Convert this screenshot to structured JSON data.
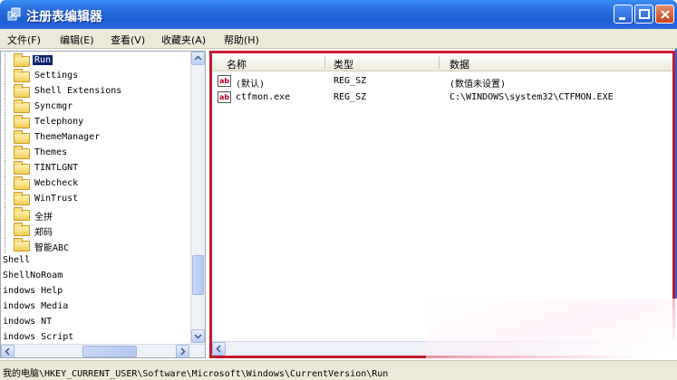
{
  "window": {
    "title": "注册表编辑器",
    "title_icon": "regedit-icon"
  },
  "menu": {
    "items": [
      {
        "label": "文件(F)"
      },
      {
        "label": "编辑(E)"
      },
      {
        "label": "查看(V)"
      },
      {
        "label": "收藏夹(A)"
      },
      {
        "label": "帮助(H)"
      }
    ]
  },
  "tree": {
    "items": [
      {
        "label": "Run",
        "selected": true,
        "folder": true
      },
      {
        "label": "Settings",
        "folder": true
      },
      {
        "label": "Shell Extensions",
        "folder": true
      },
      {
        "label": "Syncmgr",
        "folder": true
      },
      {
        "label": "Telephony",
        "folder": true
      },
      {
        "label": "ThemeManager",
        "folder": true
      },
      {
        "label": "Themes",
        "folder": true
      },
      {
        "label": "TINTLGNT",
        "folder": true
      },
      {
        "label": "Webcheck",
        "folder": true
      },
      {
        "label": "WinTrust",
        "folder": true
      },
      {
        "label": "全拼",
        "folder": true
      },
      {
        "label": "郑码",
        "folder": true
      },
      {
        "label": "智能ABC",
        "folder": true
      },
      {
        "label": "Shell",
        "folder": false
      },
      {
        "label": "ShellNoRoam",
        "folder": false
      },
      {
        "label": "indows Help",
        "folder": false
      },
      {
        "label": "indows Media",
        "folder": false
      },
      {
        "label": "indows NT",
        "folder": false
      },
      {
        "label": "indows Script",
        "folder": false
      }
    ]
  },
  "list": {
    "columns": [
      "名称",
      "类型",
      "数据"
    ],
    "rows": [
      {
        "name": "(默认)",
        "type": "REG_SZ",
        "data": "(数值未设置)"
      },
      {
        "name": "ctfmon.exe",
        "type": "REG_SZ",
        "data": "C:\\WINDOWS\\system32\\CTFMON.EXE"
      }
    ]
  },
  "status": {
    "path": "我的电脑\\HKEY_CURRENT_USER\\Software\\Microsoft\\Windows\\CurrentVersion\\Run"
  },
  "colors": {
    "highlight_border": "#c21b2e",
    "selection": "#0a246a",
    "titlebar": "#2a6fe0"
  }
}
